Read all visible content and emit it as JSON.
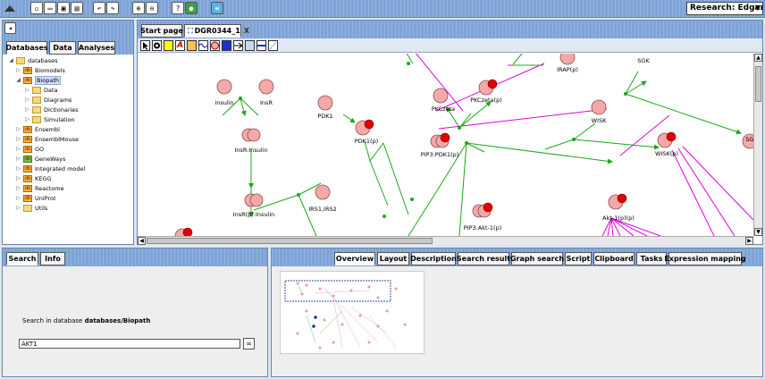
{
  "toolbar": {
    "buttons": [
      "new-icon",
      "open-icon",
      "save-icon",
      "save-all-icon",
      "undo-icon",
      "redo-icon",
      "zoom-in-icon",
      "zoom-out-icon",
      "help-icon",
      "globe-icon",
      "document-icon"
    ],
    "research_label": "Research: Edgar"
  },
  "left_panel": {
    "tabs": [
      "Databases",
      "Data",
      "Analyses"
    ],
    "tree": [
      {
        "label": "databases",
        "level": 0,
        "icon": "folder",
        "expanded": true
      },
      {
        "label": "Biomodels",
        "level": 1,
        "icon": "db"
      },
      {
        "label": "Biopath",
        "level": 1,
        "icon": "db",
        "expanded": true,
        "selected": true
      },
      {
        "label": "Data",
        "level": 2,
        "icon": "folder"
      },
      {
        "label": "Diagrams",
        "level": 2,
        "icon": "folder"
      },
      {
        "label": "Dictionaries",
        "level": 2,
        "icon": "folder"
      },
      {
        "label": "Simulation",
        "level": 2,
        "icon": "folder"
      },
      {
        "label": "Ensembl",
        "level": 1,
        "icon": "db"
      },
      {
        "label": "EnsemblMouse",
        "level": 1,
        "icon": "db"
      },
      {
        "label": "GO",
        "level": 1,
        "icon": "db"
      },
      {
        "label": "GeneWays",
        "level": 1,
        "icon": "db"
      },
      {
        "label": "Integrated model",
        "level": 1,
        "icon": "db"
      },
      {
        "label": "KEGG",
        "level": 1,
        "icon": "db"
      },
      {
        "label": "Reactome",
        "level": 1,
        "icon": "db"
      },
      {
        "label": "UniProt",
        "level": 1,
        "icon": "db"
      },
      {
        "label": "Utils",
        "level": 1,
        "icon": "folder"
      }
    ]
  },
  "editor": {
    "tabs": [
      "Start page",
      "DGR0344_1"
    ],
    "close_label": "X",
    "palette": [
      "select-icon",
      "node-icon",
      "rect-icon",
      "text-icon",
      "folder-tool-icon",
      "edge-wave-icon",
      "circle-icon",
      "square-icon",
      "reaction-icon",
      "table-icon",
      "line-icon",
      "dashed-line-icon"
    ],
    "diagram_labels": {
      "insulin": "insulin",
      "insr": "InsR",
      "insr_insulin": "InsR:Insulin",
      "insrp_insulin": "InsR(p):Insulin",
      "irs": "IRS1,IRS2",
      "pdk1": "PDK1",
      "pdk1p": "PDK1(p)",
      "pkczeta": "PKCzeta",
      "pkczetap": "PKCzeta(p)",
      "irap": "IRAP(p)",
      "sgk": "SGK",
      "wisk": "WISK",
      "wiskp": "WISK(p)",
      "pip3pdk1": "PIP3:PDK1(p)",
      "pip3akt": "PIP3:Akt-1(p)",
      "aktp": "Akt-1(p)(p)",
      "sg": "SG"
    }
  },
  "search_panel": {
    "tabs": [
      "Search",
      "Info"
    ],
    "prompt": "Search in database",
    "database": "databases/Biopath",
    "query": "AKT1"
  },
  "overview_panel": {
    "tabs": [
      "Overview",
      "Layout",
      "Description",
      "Search result",
      "Graph search",
      "Script",
      "Clipboard",
      "Tasks",
      "Expression mapping"
    ]
  }
}
